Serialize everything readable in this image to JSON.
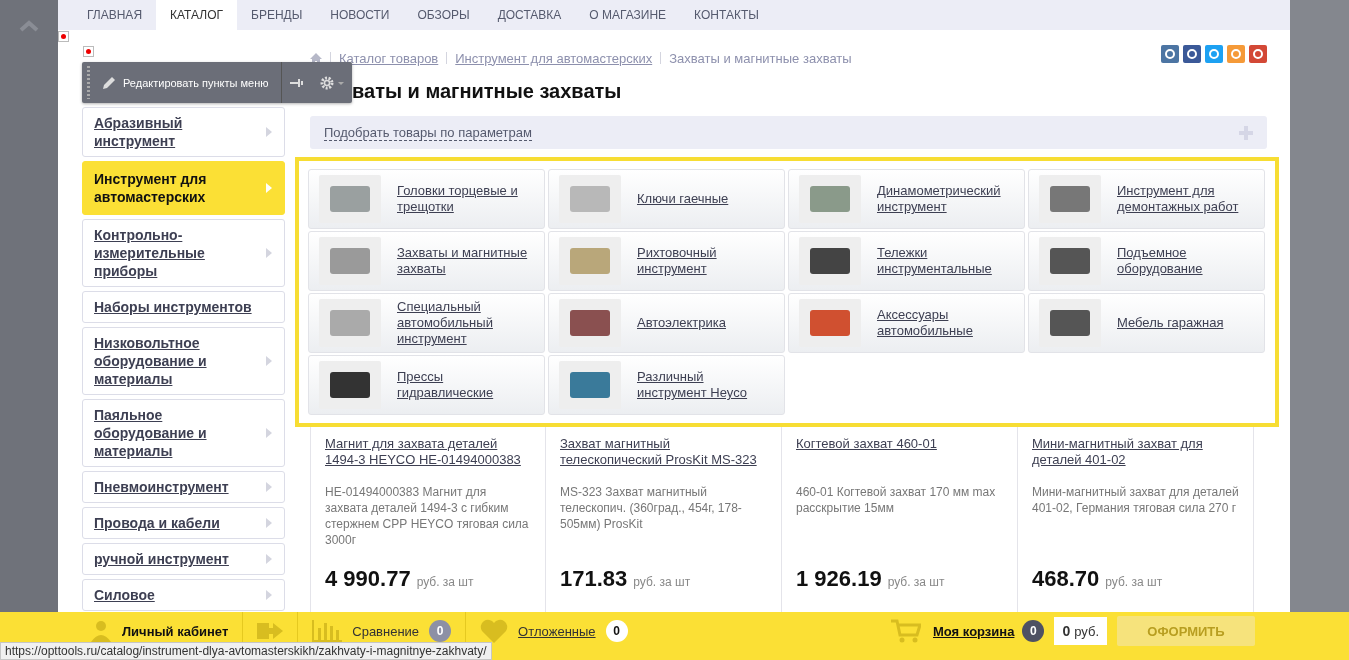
{
  "nav": {
    "tabs": [
      {
        "label": "ГЛАВНАЯ",
        "selected": false
      },
      {
        "label": "КАТАЛОГ",
        "selected": true
      },
      {
        "label": "БРЕНДЫ",
        "selected": false
      },
      {
        "label": "НОВОСТИ",
        "selected": false
      },
      {
        "label": "ОБЗОРЫ",
        "selected": false
      },
      {
        "label": "ДОСТАВКА",
        "selected": false
      },
      {
        "label": "О МАГАЗИНЕ",
        "selected": false
      },
      {
        "label": "КОНТАКТЫ",
        "selected": false
      }
    ]
  },
  "edit_toolbar": {
    "label": "Редактировать пункты меню"
  },
  "breadcrumb": {
    "links": [
      "Каталог товаров",
      "Инструмент для автомастерских"
    ],
    "current": "Захваты и магнитные захваты"
  },
  "title": "ваты и магнитные захваты",
  "filter": {
    "label": "Подобрать товары по параметрам"
  },
  "sidebar": {
    "items": [
      {
        "label": "Абразивный инструмент",
        "selected": false,
        "has_submenu": true
      },
      {
        "label": "Инструмент для автомастерских",
        "selected": true,
        "has_submenu": true
      },
      {
        "label": "Контрольно-измерительные приборы",
        "selected": false,
        "has_submenu": true
      },
      {
        "label": "Наборы инструментов",
        "selected": false,
        "has_submenu": false
      },
      {
        "label": "Низковольтное оборудование и материалы",
        "selected": false,
        "has_submenu": true
      },
      {
        "label": "Паяльное оборудование и материалы",
        "selected": false,
        "has_submenu": true
      },
      {
        "label": "Пневмоинструмент",
        "selected": false,
        "has_submenu": true
      },
      {
        "label": "Провода и кабели",
        "selected": false,
        "has_submenu": true
      },
      {
        "label": "ручной инструмент",
        "selected": false,
        "has_submenu": true
      },
      {
        "label": "Силовое",
        "selected": false,
        "has_submenu": true
      }
    ]
  },
  "subcategories": [
    {
      "label": "Головки торцевые и трещотки"
    },
    {
      "label": "Ключи гаечные"
    },
    {
      "label": "Динамометрический инструмент"
    },
    {
      "label": "Инструмент для демонтажных работ"
    },
    {
      "label": "Захваты и магнитные захваты"
    },
    {
      "label": "Рихтовочный инструмент"
    },
    {
      "label": "Тележки инструментальные"
    },
    {
      "label": "Подъемное оборудование"
    },
    {
      "label": "Специальный автомобильный инструмент"
    },
    {
      "label": "Автоэлектрика"
    },
    {
      "label": "Аксессуары автомобильные"
    },
    {
      "label": "Мебель гаражная"
    },
    {
      "label": "Прессы гидравлические"
    },
    {
      "label": "Различный инструмент Heyco"
    }
  ],
  "products": [
    {
      "title": "Магнит для захвата деталей 1494-3 HEYCO HE-01494000383",
      "description": "HE-01494000383 Магнит для захвата деталей 1494-3 с гибким стержнем СРР HEYCO тяговая сила 3000г",
      "price": "4 990.77",
      "unit": "руб. за шт"
    },
    {
      "title": "Захват магнитный телескопический ProsKit MS-323",
      "description": "MS-323 Захват магнитный телескопич. (360град., 454г, 178-505мм) ProsKit",
      "price": "171.83",
      "unit": "руб. за шт"
    },
    {
      "title": "Когтевой захват 460-01",
      "description": "460-01 Когтевой захват 170 мм max расскрытие 15мм",
      "price": "1 926.19",
      "unit": "руб. за шт"
    },
    {
      "title": "Мини-магнитный захват для деталей 401-02",
      "description": "Мини-магнитный захват для деталей 401-02, Германия тяговая сила 270 г",
      "price": "468.70",
      "unit": "руб. за шт"
    }
  ],
  "bottom_bar": {
    "account": "Личный кабинет",
    "compare": {
      "label": "Сравнение",
      "count": "0"
    },
    "wishlist": {
      "label": "Отложенные",
      "count": "0"
    },
    "cart": {
      "label": "Моя корзина",
      "count": "0",
      "total": "0",
      "currency": "руб."
    },
    "checkout": {
      "label": "ОФОРМИТЬ",
      "disabled": true
    }
  },
  "status_url": "https://opttools.ru/catalog/instrument-dlya-avtomasterskikh/zakhvaty-i-magnitnye-zakhvaty/"
}
